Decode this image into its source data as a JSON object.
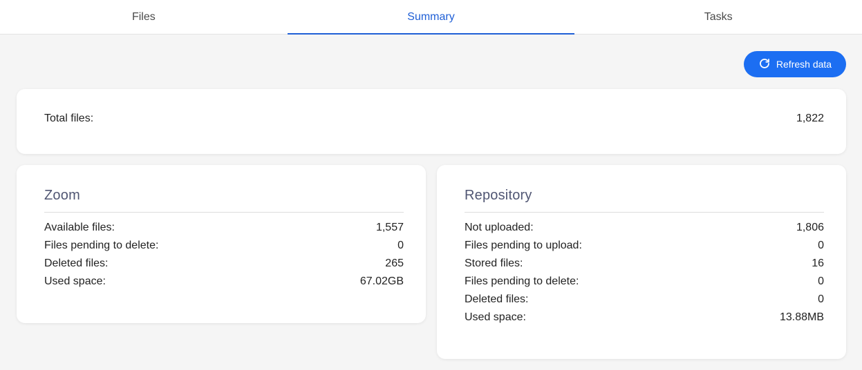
{
  "tabs": [
    {
      "label": "Files",
      "active": false
    },
    {
      "label": "Summary",
      "active": true
    },
    {
      "label": "Tasks",
      "active": false
    }
  ],
  "toolbar": {
    "refresh_label": "Refresh data",
    "refresh_icon": "refresh-icon"
  },
  "total": {
    "label": "Total files:",
    "value": "1,822"
  },
  "zoom": {
    "title": "Zoom",
    "rows": [
      {
        "label": "Available files:",
        "value": "1,557"
      },
      {
        "label": "Files pending to delete:",
        "value": "0"
      },
      {
        "label": "Deleted files:",
        "value": "265"
      },
      {
        "label": "Used space:",
        "value": "67.02GB"
      }
    ]
  },
  "repository": {
    "title": "Repository",
    "rows": [
      {
        "label": "Not uploaded:",
        "value": "1,806"
      },
      {
        "label": "Files pending to upload:",
        "value": "0"
      },
      {
        "label": "Stored files:",
        "value": "16"
      },
      {
        "label": "Files pending to delete:",
        "value": "0"
      },
      {
        "label": "Deleted files:",
        "value": "0"
      },
      {
        "label": "Used space:",
        "value": "13.88MB"
      }
    ]
  },
  "colors": {
    "accent": "#1f5fd6",
    "button": "#1c6ef2",
    "card_title": "#505673",
    "background": "#f5f5f5"
  }
}
